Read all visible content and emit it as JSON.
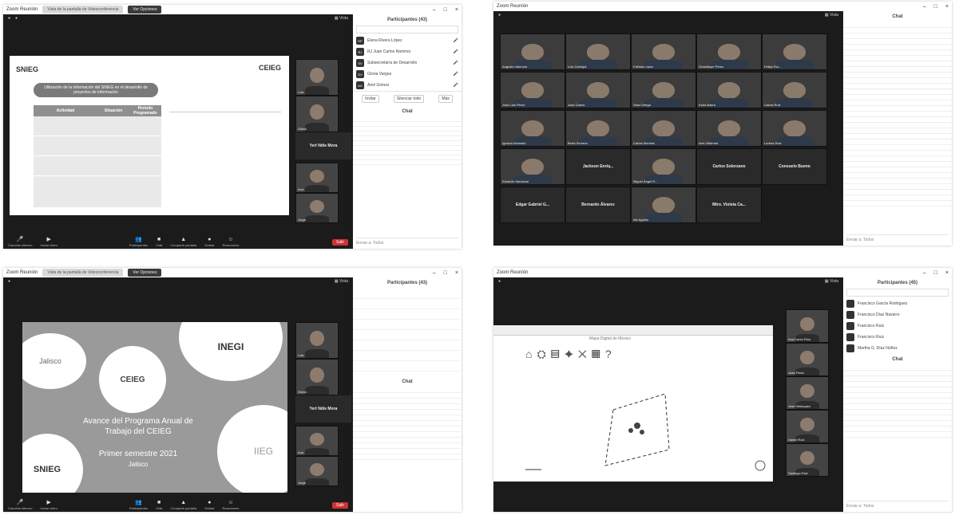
{
  "shot1": {
    "title": "Zoom Reunión",
    "tab_a": "Vista de la pantalla de Videoconferencia",
    "tab_b": "Ver Opciones",
    "slide": {
      "logo_left": "SNIEG",
      "logo_right": "CEIEG",
      "heading": "Utilización de la información del SNIEG en el desarrollo de proyectos de información",
      "col1": "Actividad",
      "col2": "Situación",
      "col3": "Periodo Programado"
    },
    "presenter_label": "Yerl Ndie Mora",
    "participants_title": "Participantes (43)",
    "participants": [
      {
        "initials": "EP",
        "name": "Elena Rivera López"
      },
      {
        "initials": "RJ",
        "name": "RJ Juan Carlos Ramírez"
      },
      {
        "initials": "SV",
        "name": "Subsecretaría de Desarrollo"
      },
      {
        "initials": "GV",
        "name": "Gloria Vargas"
      },
      {
        "initials": "AG",
        "name": "Ariel Gómez"
      }
    ],
    "btns": [
      "Invitar",
      "Silenciar todo",
      "Más"
    ],
    "chat_title": "Chat",
    "chat_input": "Enviar a: Todos"
  },
  "shot2": {
    "title": "Zoom Reunión",
    "chat_title": "Chat",
    "names": [
      "Augusto Valencia",
      "Luis Carbajal",
      "Fabiola López",
      "Guadalupe Pérez",
      "Felipe Rui...",
      "Jose Luis Pérez",
      "Juan Carlos",
      "Sara Ortega",
      "Karla Ibarra",
      "Carlos Ruiz",
      "Ignacio Alvarado",
      "Berta Serrano",
      "Carlos Morales",
      "Inés Villarreal",
      "Lorena Ruiz",
      "Eduardo Sandoval",
      "Jackson Enriq...",
      "Miguel Ángel R...",
      "Carlos Solorzano",
      "Consuelo Bueno",
      "Edgar Gabriel G...",
      "Bernardo Álvarez",
      "Ale Aguilar",
      "Mtro. Violeta Ca..."
    ],
    "chat_input": "Enviar a: Todos"
  },
  "shot3": {
    "title": "Zoom Reunión",
    "tab_a": "Vista de la pantalla de Videoconferencia",
    "tab_b": "Ver Opciones",
    "slide_title": "Avance del Programa Anual de Trabajo del CEIEG",
    "slide_sub": "Primer semestre 2021",
    "slide_place": "Jalisco",
    "logos": [
      "Jalisco",
      "CEIEG",
      "INEGI",
      "SNIEG",
      "IIEG"
    ],
    "presenter_label": "Yerl Ndie Mora",
    "participants_title": "Participantes (43)",
    "chat_title": "Chat"
  },
  "shot4": {
    "title": "Zoom Reunión",
    "participants_title": "Participantes (45)",
    "chat_title": "Chat",
    "participants": [
      "Francisco García Rodríguez",
      "Francisco Díaz Navarro",
      "Francisco Ruiz",
      "Francisco Ruiz",
      "Martha G. Díaz Núñez"
    ],
    "thumb_names": [
      "Ana Karen Rios",
      "Juan Pérez",
      "José Velázquez",
      "Daniel Ruiz",
      "Santiago Ruiz"
    ],
    "map_title": "Mapa Digital de México",
    "chat_input": "Enviar a: Todos"
  },
  "toolbar": {
    "mute": "Cancelar silencio",
    "video": "Iniciar video",
    "participants": "Participantes",
    "chat": "Chat",
    "share": "Compartir pantalla",
    "record": "Grabar",
    "reactions": "Reacciones",
    "leave": "Salir"
  }
}
